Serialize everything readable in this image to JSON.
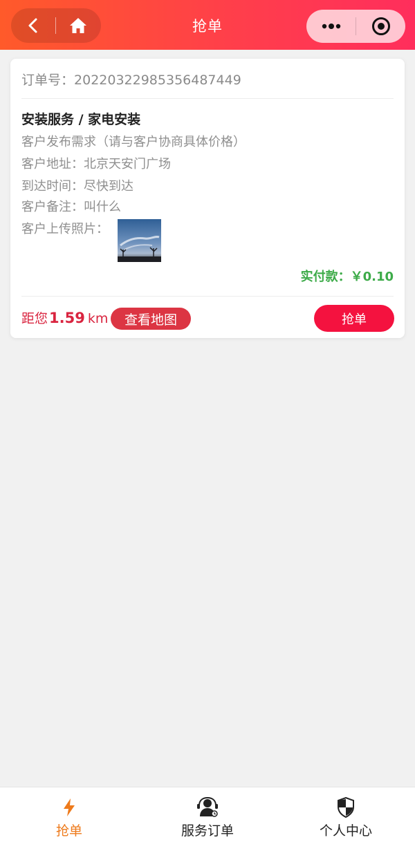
{
  "header": {
    "title": "抢单"
  },
  "order": {
    "order_no_label": "订单号：",
    "order_no": "202203229853564874​49",
    "service_title": "安装服务 / 家电安装",
    "lines": [
      "客户发布需求（请与客户协商具体价格）",
      "客户地址：北京天安门广场",
      "到达时间：尽快到达",
      "客户备注：叫什么",
      "客户上传照片："
    ],
    "amount": "实付款：￥0.10",
    "distance_prefix": "距您",
    "distance_value": "1.59",
    "distance_unit": "km",
    "map_button": "查看地图",
    "grab_button": "抢单"
  },
  "tabbar": {
    "items": [
      {
        "label": "抢单",
        "icon": "lightning-icon",
        "active": true
      },
      {
        "label": "服务订单",
        "icon": "service-agent-icon",
        "active": false
      },
      {
        "label": "个人中心",
        "icon": "shield-icon",
        "active": false
      }
    ]
  },
  "colors": {
    "header_start": "#ff5a2a",
    "header_end": "#ff2e5c",
    "accent_red": "#f4123f",
    "amount_green": "#3dab49",
    "tab_active": "#ee7a1b"
  }
}
